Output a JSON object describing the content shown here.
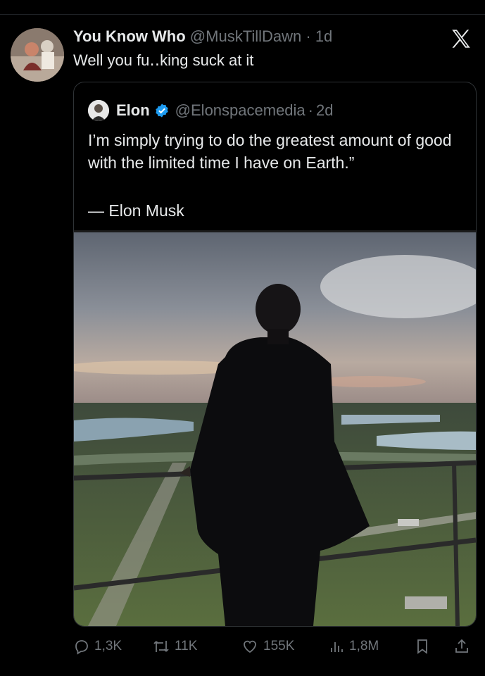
{
  "tweet": {
    "author_name": "You Know Who",
    "handle": "@MuskTillDawn",
    "separator": "·",
    "time": "1d",
    "text": "Well you fu․․king suck at it",
    "avatar_icon": "profile-photo-avatar"
  },
  "app": {
    "logo_icon": "x-logo-icon"
  },
  "quote": {
    "author_name": "Elon",
    "handle": "@Elonspacemedia",
    "separator": "·",
    "time": "2d",
    "text": "I’m simply trying to do the greatest amount of good with the limited time I have on Earth.”",
    "attribution": "— Elon Musk",
    "verified_color": "#1d9bf0",
    "image_description_icon": "man-on-balcony-photo"
  },
  "actions": {
    "replies": "1,3K",
    "reposts": "11K",
    "likes": "155K",
    "views": "1,8M"
  },
  "colors": {
    "background": "#000000",
    "text": "#e7e9ea",
    "muted": "#71767b",
    "border": "#2f3336"
  }
}
